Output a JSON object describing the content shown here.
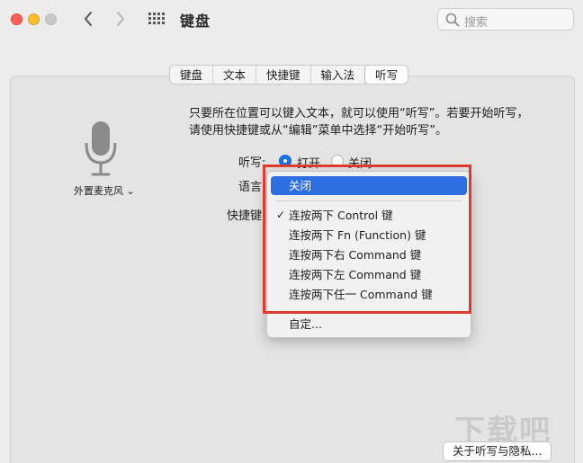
{
  "window": {
    "title": "键盘"
  },
  "search": {
    "placeholder": "搜索"
  },
  "tabs": [
    {
      "label": "键盘",
      "active": false
    },
    {
      "label": "文本",
      "active": false
    },
    {
      "label": "快捷键",
      "active": false
    },
    {
      "label": "输入法",
      "active": false
    },
    {
      "label": "听写",
      "active": true
    }
  ],
  "mic": {
    "label": "外置麦克风 ⌄"
  },
  "description": "只要所在位置可以键入文本，就可以使用“听写”。若要开始听写，请使用快捷键或从“编辑”菜单中选择“开始听写”。",
  "dictation": {
    "label": "听写:",
    "on_label": "打开",
    "off_label": "关闭",
    "selected": "on"
  },
  "language": {
    "label": "语言"
  },
  "shortcut": {
    "label": "快捷键"
  },
  "shortcut_menu": {
    "items": [
      {
        "label": "关闭",
        "highlighted": true,
        "checked": false
      },
      {
        "label": "连按两下 Control 键",
        "highlighted": false,
        "checked": true
      },
      {
        "label": "连按两下 Fn (Function) 键",
        "highlighted": false,
        "checked": false
      },
      {
        "label": "连按两下右 Command 键",
        "highlighted": false,
        "checked": false
      },
      {
        "label": "连按两下左 Command 键",
        "highlighted": false,
        "checked": false
      },
      {
        "label": "连按两下任一 Command 键",
        "highlighted": false,
        "checked": false
      }
    ],
    "customize": "自定..."
  },
  "about_button": "关于听写与隐私...",
  "watermark": "下载吧",
  "colors": {
    "accent": "#2d6fe0",
    "annotation": "#e03a2e"
  }
}
